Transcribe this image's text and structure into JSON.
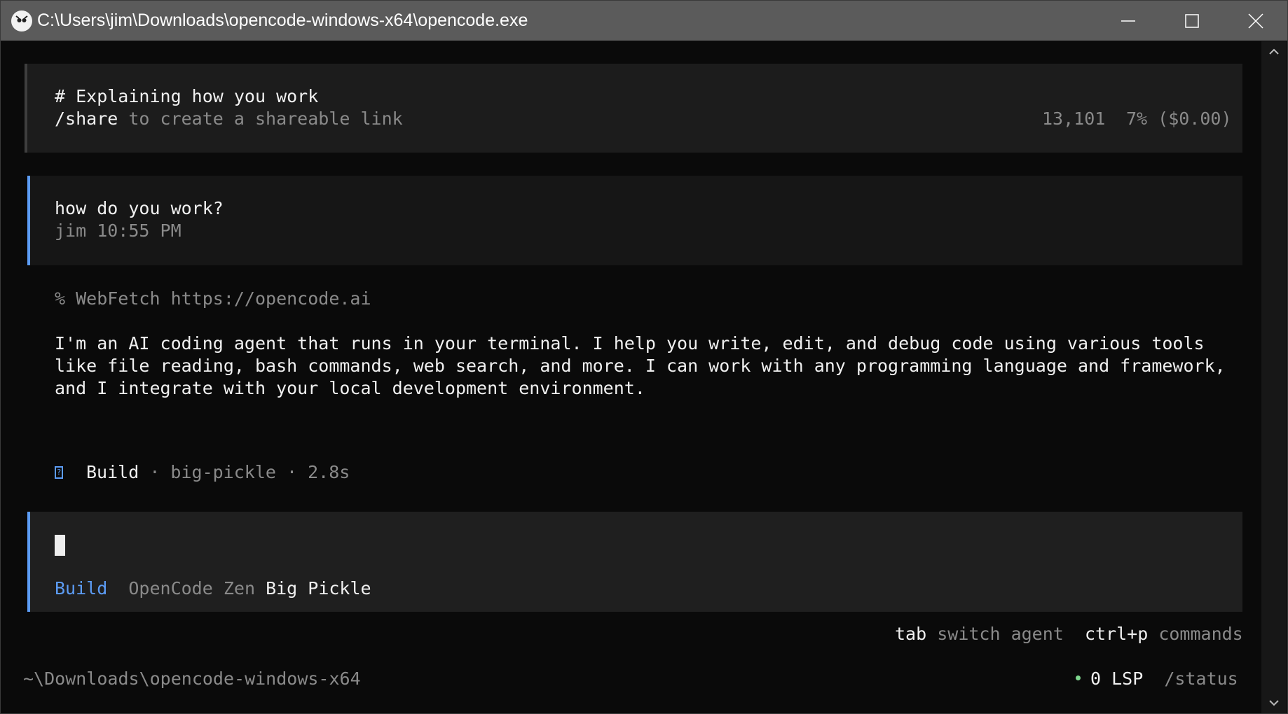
{
  "window": {
    "title": "C:\\Users\\jim\\Downloads\\opencode-windows-x64\\opencode.exe"
  },
  "session": {
    "title": "# Explaining how you work",
    "share_command": "/share",
    "share_hint": " to create a shareable link",
    "tokens": "13,101",
    "usage": "7% ($0.00)"
  },
  "user_message": {
    "text": "how do you work?",
    "meta": "jim 10:55 PM"
  },
  "assistant": {
    "tool_call": "% WebFetch https://opencode.ai",
    "reply_lines": [
      "I'm an AI coding agent that runs in your terminal. I help you write, edit, and debug code using various tools",
      "like file reading, bash commands, web search, and more. I can work with any programming language and framework,",
      "and I integrate with your local development environment."
    ],
    "footer_agent": "Build",
    "footer_meta": " · big-pickle · 2.8s"
  },
  "prompt": {
    "agent": "Build",
    "provider": "OpenCode Zen",
    "model": "Big Pickle"
  },
  "hints": {
    "tab_key": "tab",
    "tab_action": "switch agent",
    "cmd_key": "ctrl+p",
    "cmd_action": "commands"
  },
  "statusbar": {
    "path": "~\\Downloads\\opencode-windows-x64",
    "lsp": "0 LSP",
    "status_command": "/status"
  },
  "colors": {
    "accent": "#5c9cf5",
    "lsp_ok": "#7fd88f",
    "background": "#0a0a0a"
  }
}
